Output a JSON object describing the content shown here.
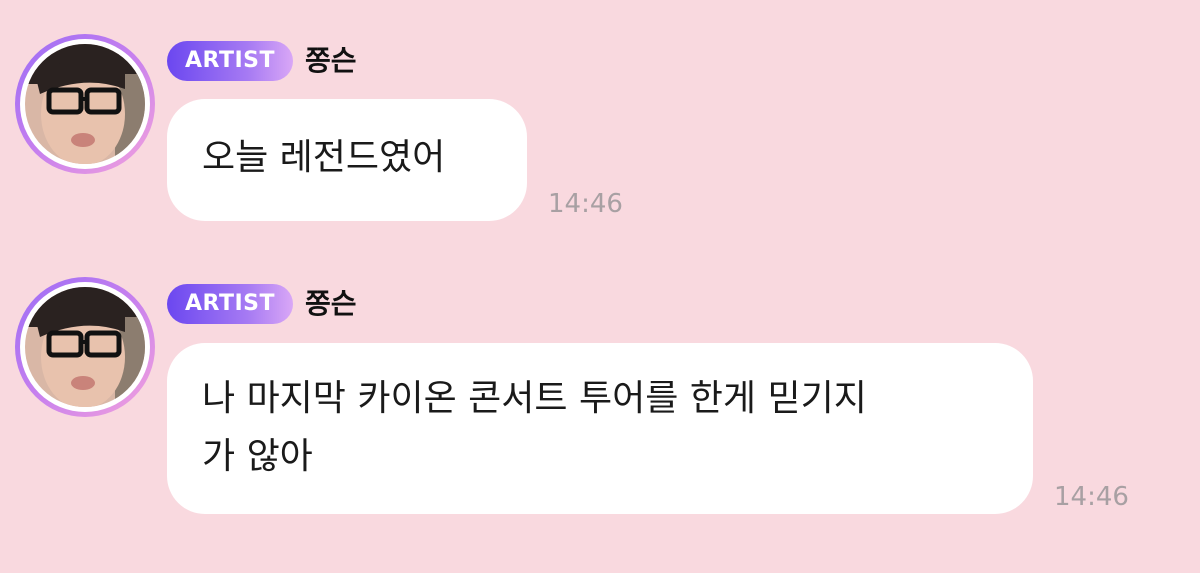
{
  "messages": [
    {
      "badge": "ARTIST",
      "sender": "쫑슨",
      "text": "오늘 레전드였어",
      "time": "14:46"
    },
    {
      "badge": "ARTIST",
      "sender": "쫑슨",
      "text_lines": [
        "나 마지막 카이온 콘서트 투어를 한게 믿기지",
        "가 않아"
      ],
      "time": "14:46"
    }
  ]
}
